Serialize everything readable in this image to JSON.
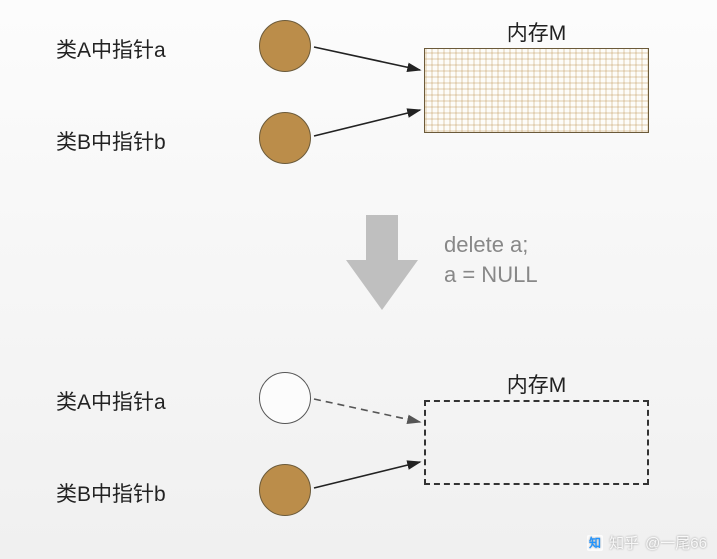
{
  "top": {
    "labelA": "类A中指针a",
    "labelB": "类B中指针b",
    "memTitle": "内存M"
  },
  "transition": {
    "code": "delete a;\na = NULL"
  },
  "bottom": {
    "labelA": "类A中指针a",
    "labelB": "类B中指针b",
    "memTitle": "内存M"
  },
  "watermark": {
    "site": "知乎",
    "user": "@一尾66"
  }
}
